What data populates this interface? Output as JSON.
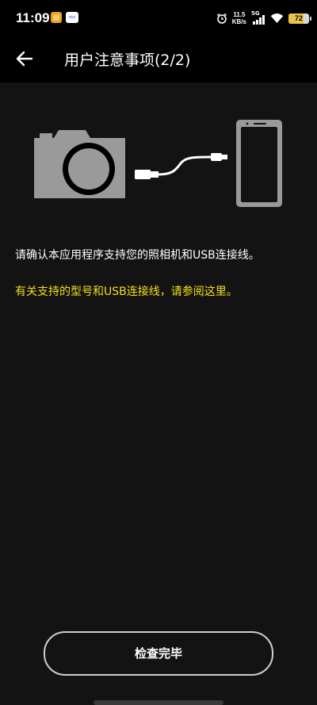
{
  "status_bar": {
    "time": "11:09",
    "app_icon_label": "vivo",
    "net_speed_value": "11.5",
    "net_speed_unit": "KB/s",
    "network_type": "5G",
    "battery_level": "72"
  },
  "header": {
    "title": "用户注意事项(2/2)",
    "back_icon": "arrow-left-icon"
  },
  "illustration": {
    "camera_icon": "camera-icon",
    "cable_icon": "usb-cable-icon",
    "phone_icon": "smartphone-icon",
    "color": "#9a9a9a"
  },
  "main": {
    "instruction": "请确认本应用程序支持您的照相机和USB连接线。",
    "link": "有关支持的型号和USB连接线，请参阅这里。"
  },
  "footer": {
    "check_button_label": "检查完毕"
  },
  "colors": {
    "background": "#131313",
    "bar": "#000000",
    "link": "#f5e016",
    "battery": "#e8c44a"
  }
}
